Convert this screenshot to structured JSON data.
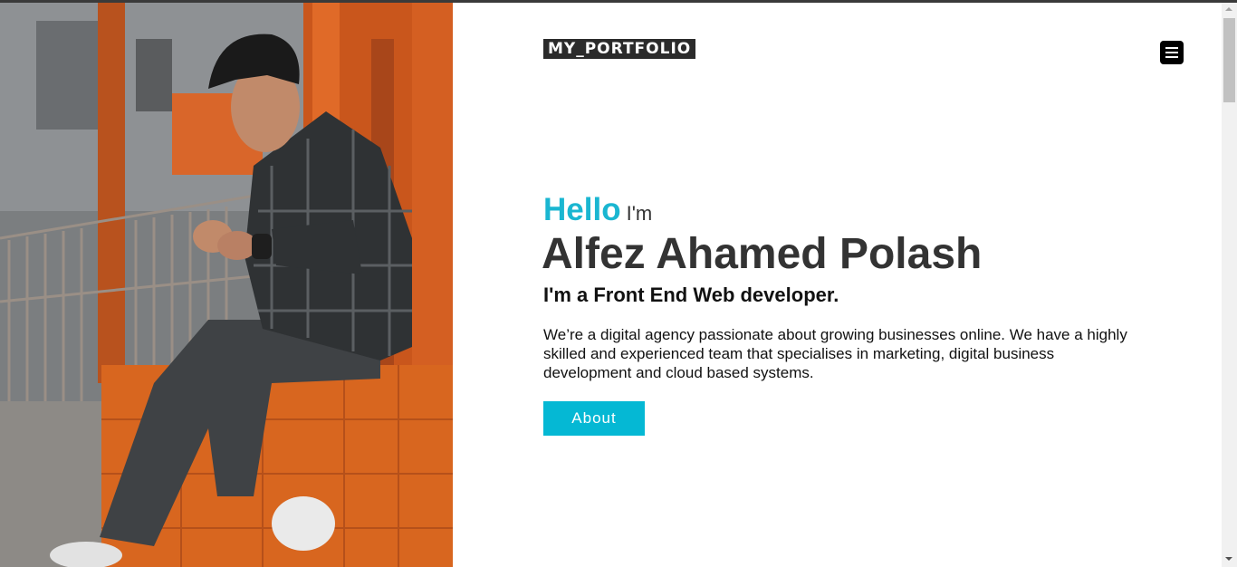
{
  "header": {
    "brand": "MY_PORTFOLIO",
    "menu_icon": "hamburger-menu-icon"
  },
  "hero": {
    "photo": "portrait-photo",
    "greeting": "Hello",
    "greeting_suffix": "I'm",
    "name": "Alfez Ahamed Polash",
    "role": "I'm a Front End Web developer.",
    "description": "We’re a digital agency passionate about growing businesses online. We have a highly skilled and experienced team that specialises in marketing, digital business development and cloud based systems.",
    "about_button": "About"
  },
  "colors": {
    "accent": "#1ab6d1",
    "button": "#05b8d4",
    "brand_bg": "#2b2b2b",
    "heading": "#333333"
  }
}
